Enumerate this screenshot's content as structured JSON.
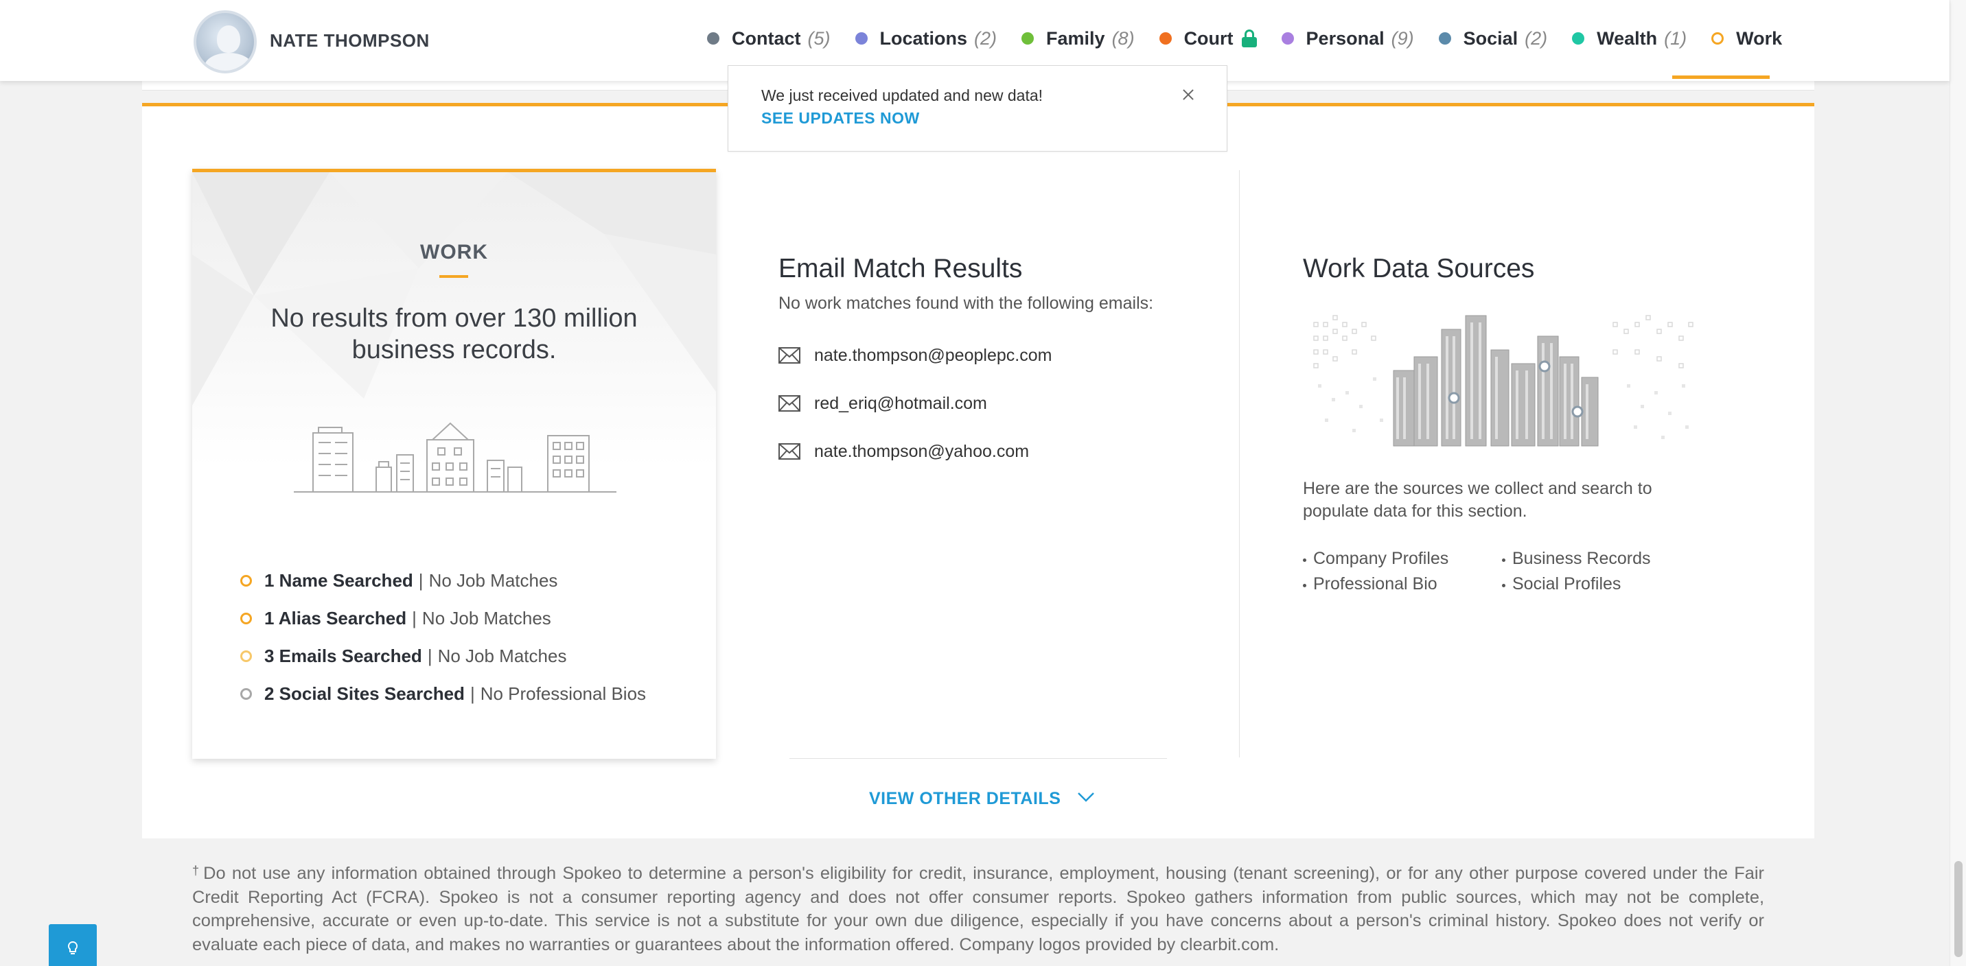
{
  "header": {
    "person_name": "NATE THOMPSON",
    "nav": [
      {
        "label": "Contact",
        "count": "(5)",
        "color": "#6f7b87"
      },
      {
        "label": "Locations",
        "count": "(2)",
        "color": "#7b83d9"
      },
      {
        "label": "Family",
        "count": "(8)",
        "color": "#6fbf3a"
      },
      {
        "label": "Court",
        "count": "",
        "color": "#f07020",
        "icon": "lock-icon"
      },
      {
        "label": "Personal",
        "count": "(9)",
        "color": "#a97fe0"
      },
      {
        "label": "Social",
        "count": "(2)",
        "color": "#5b8aaa"
      },
      {
        "label": "Wealth",
        "count": "(1)",
        "color": "#1fc7a4"
      },
      {
        "label": "Work",
        "count": "",
        "color": "#f5a623",
        "active": true
      }
    ]
  },
  "toast": {
    "message": "We just received updated and new data!",
    "link": "SEE UPDATES NOW"
  },
  "work_panel": {
    "title": "WORK",
    "headline": "No results from over 130 million business records.",
    "stats": [
      {
        "strong": "1 Name Searched",
        "detail": "No Job Matches",
        "color": "#f5a623"
      },
      {
        "strong": "1 Alias Searched",
        "detail": "No Job Matches",
        "color": "#f5a623"
      },
      {
        "strong": "3 Emails Searched",
        "detail": "No Job Matches",
        "color": "#f7c86a"
      },
      {
        "strong": "2 Social Sites Searched",
        "detail": "No Professional Bios",
        "color": "#a8a8a8"
      }
    ]
  },
  "email_match": {
    "heading": "Email Match Results",
    "subtext": "No work matches found with the following emails:",
    "emails": [
      "nate.thompson@peoplepc.com",
      "red_eriq@hotmail.com",
      "nate.thompson@yahoo.com"
    ]
  },
  "data_sources": {
    "heading": "Work Data Sources",
    "description": "Here are the sources we collect and search to populate data for this section.",
    "items": [
      "Company Profiles",
      "Business Records",
      "Professional Bio",
      "Social Profiles"
    ]
  },
  "view_details": "VIEW OTHER DETAILS",
  "disclaimer": {
    "mark": "†",
    "text": "Do not use any information obtained through Spokeo to determine a person's eligibility for credit, insurance, employment, housing (tenant screening), or for any other purpose covered under the Fair Credit Reporting Act (FCRA). Spokeo is not a consumer reporting agency and does not offer consumer reports. Spokeo gathers information from public sources, which may not be complete, comprehensive, accurate or even up-to-date. This service is not a substitute for your own due diligence, especially if you have concerns about a person's criminal history. Spokeo does not verify or evaluate each piece of data, and makes no warranties or guarantees about the information offered. Company logos provided by clearbit.com."
  },
  "colors": {
    "accent": "#f5a623",
    "link": "#1f9ad6",
    "lock": "#18b07c"
  }
}
